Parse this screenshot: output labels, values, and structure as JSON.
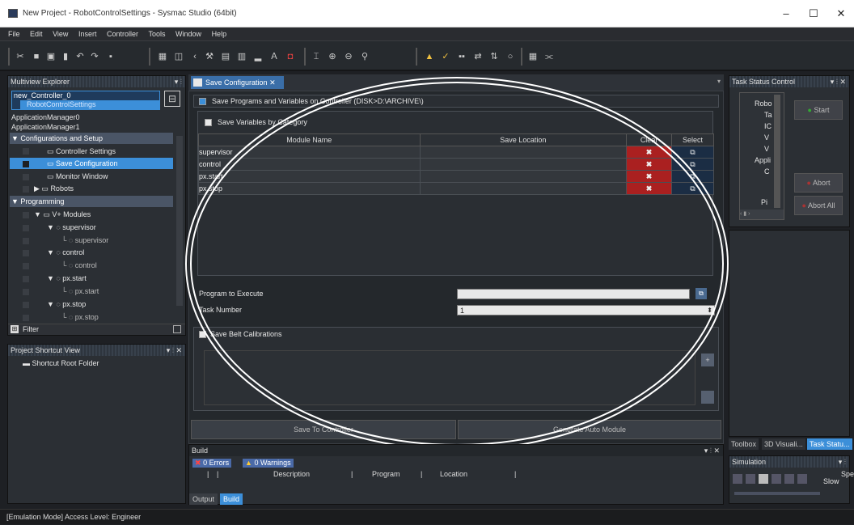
{
  "window": {
    "title": "New Project - RobotControlSettings - Sysmac Studio (64bit)",
    "minimize": "–",
    "maximize": "☐",
    "close": "✕"
  },
  "menu": [
    "File",
    "Edit",
    "View",
    "Insert",
    "Controller",
    "Tools",
    "Window",
    "Help"
  ],
  "multiview": {
    "title": "Multiview Explorer",
    "controller": "new_Controller_0",
    "controller_sub": "RobotControlSettings",
    "managers": [
      "ApplicationManager0",
      "ApplicationManager1"
    ],
    "config_group": "Configurations and Setup",
    "items": [
      "Controller Settings",
      "Save Configuration",
      "Monitor Window",
      "Robots"
    ],
    "programming_group": "Programming",
    "vplus": "V+ Modules",
    "modules": [
      {
        "name": "supervisor",
        "child": "supervisor"
      },
      {
        "name": "control",
        "child": "control"
      },
      {
        "name": "px.start",
        "child": "px.start"
      },
      {
        "name": "px.stop",
        "child": "px.stop"
      }
    ],
    "filter": "Filter"
  },
  "shortcut": {
    "title": "Project Shortcut View",
    "root": "Shortcut Root Folder"
  },
  "main": {
    "tab": "Save Configuration",
    "save_programs": "Save Programs and Variables on Controller (DISK>D:\\ARCHIVE\\)",
    "save_vars": "Save Variables by Category",
    "columns": [
      "Module Name",
      "Save Location",
      "Clear",
      "Select"
    ],
    "rows": [
      "supervisor",
      "control",
      "px.start",
      "px.stop"
    ],
    "program_to_execute": "Program to Execute",
    "task_number": "Task Number",
    "task_number_value": "1",
    "save_belt": "Save Belt Calibrations",
    "btn_save": "Save To Controller",
    "btn_generate": "Generate Auto Module"
  },
  "build": {
    "title": "Build",
    "errors": "0 Errors",
    "warnings": "0 Warnings",
    "cols": [
      "Description",
      "Program",
      "Location"
    ],
    "tabs": [
      "Output",
      "Build"
    ]
  },
  "task": {
    "title": "Task Status Control",
    "labels": [
      "Robo",
      "Ta",
      "IC",
      "V",
      "V",
      "Appli",
      "C",
      "Pi"
    ],
    "start": "Start",
    "abort": "Abort",
    "abort_all": "Abort All"
  },
  "right_tabs": [
    "Toolbox",
    "3D Visuali...",
    "Task Statu..."
  ],
  "simulation": {
    "title": "Simulation",
    "slow": "Slow",
    "spe": "Spe"
  },
  "status": "[Emulation Mode] Access Level: Engineer"
}
